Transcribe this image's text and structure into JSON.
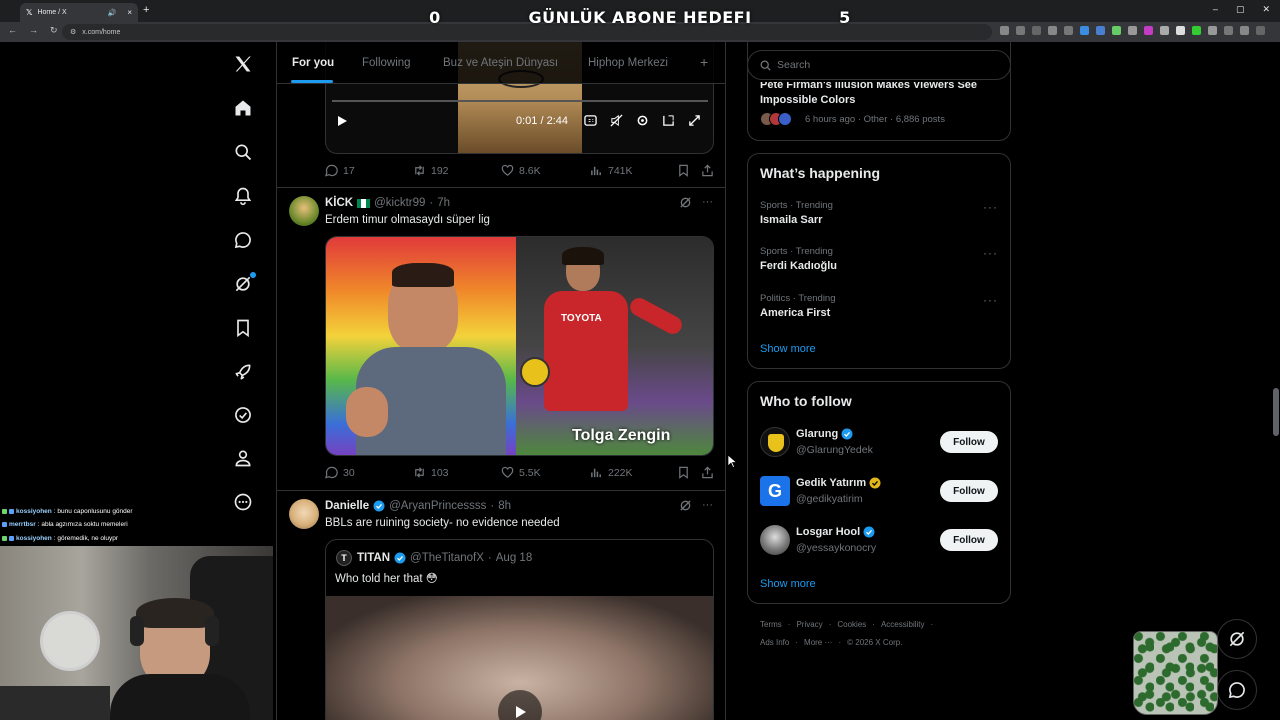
{
  "browser": {
    "tab_title": "Home / X",
    "tab_close": "×",
    "new_tab": "+",
    "url": "x.com/home",
    "window_controls": [
      "–",
      "▢",
      "✕"
    ]
  },
  "overlay": {
    "left_count": "0",
    "title": "GÜNLÜK ABONE HEDEFI",
    "right_count": "5"
  },
  "timeline": {
    "tabs": [
      "For you",
      "Following",
      "Buz ve Ateşin Dünyası",
      "Hiphop Merkezi"
    ],
    "add_tab": "+",
    "video": {
      "time": "0:01 / 2:44",
      "replies": "17",
      "reposts": "192",
      "likes": "8.6K",
      "views": "741K"
    },
    "post1": {
      "name": "KİCK",
      "handle": "@kicktr99",
      "time": "7h",
      "text": "Erdem timur olmasaydı süper lig",
      "media_caption": "Tolga Zengin",
      "jersey_text": "TOYOTA",
      "replies": "30",
      "reposts": "103",
      "likes": "5.5K",
      "views": "222K"
    },
    "post2": {
      "name": "Danielle",
      "handle": "@AryanPrincessss",
      "time": "8h",
      "text": "BBLs are ruining society- no evidence needed",
      "quote": {
        "name": "TITAN",
        "handle": "@TheTitanofX",
        "time": "Aug 18",
        "text": "Who told her that 😳",
        "avatar_letter": "T"
      }
    }
  },
  "sidebar": {
    "search_placeholder": "Search",
    "top_story": {
      "title_line1": "Pete Firman's Illusion Makes Viewers See",
      "title_line2": "Impossible Colors",
      "meta": "6 hours ago · Other · 6,886 posts"
    },
    "happening": {
      "title": "What’s happening",
      "trends": [
        {
          "meta": "Sports · Trending",
          "name": "Ismaila Sarr"
        },
        {
          "meta": "Sports · Trending",
          "name": "Ferdi Kadıoğlu"
        },
        {
          "meta": "Politics · Trending",
          "name": "America First"
        }
      ],
      "more_label": "···",
      "show_more": "Show more"
    },
    "who_to_follow": {
      "title": "Who to follow",
      "accounts": [
        {
          "name": "Glarung",
          "handle": "@GlarungYedek",
          "button": "Follow",
          "badge_color": "#1d9bf0"
        },
        {
          "name": "Gedik Yatırım",
          "handle": "@gedikyatirim",
          "button": "Follow",
          "badge_color": "#e2b719"
        },
        {
          "name": "Losgar Hool",
          "handle": "@yessaykonocry",
          "button": "Follow",
          "badge_color": "#1d9bf0"
        }
      ],
      "gedik_logo": "G",
      "show_more": "Show more"
    },
    "footer": {
      "row1": [
        "Terms",
        "·",
        "Privacy",
        "·",
        "Cookies",
        "·",
        "Accessibility",
        "·"
      ],
      "row2": [
        "Ads Info",
        "·",
        "More ···",
        "·",
        "© 2026 X Corp."
      ]
    }
  },
  "chat": [
    {
      "user": "kossiyohen",
      "message": ": bunu caponlusunu gönder",
      "badge": "#6fd36f"
    },
    {
      "user": "merrtbsr",
      "message": ": abla agzımıza soktu memeleri",
      "badge": "#5aa0ff"
    },
    {
      "user": "kossiyohen",
      "message": ": göremedik, ne oluypr",
      "badge": "#6fd36f"
    }
  ],
  "colors": {
    "accent": "#1d9bf0",
    "background": "#000000",
    "border": "#2f3336",
    "muted_text": "#71767b"
  },
  "icons": [
    "x-logo-icon",
    "home-icon",
    "explore-icon",
    "notifications-icon",
    "messages-icon",
    "grok-icon",
    "bookmarks-icon",
    "premium-icon",
    "verified-orgs-icon",
    "profile-icon",
    "more-icon"
  ]
}
